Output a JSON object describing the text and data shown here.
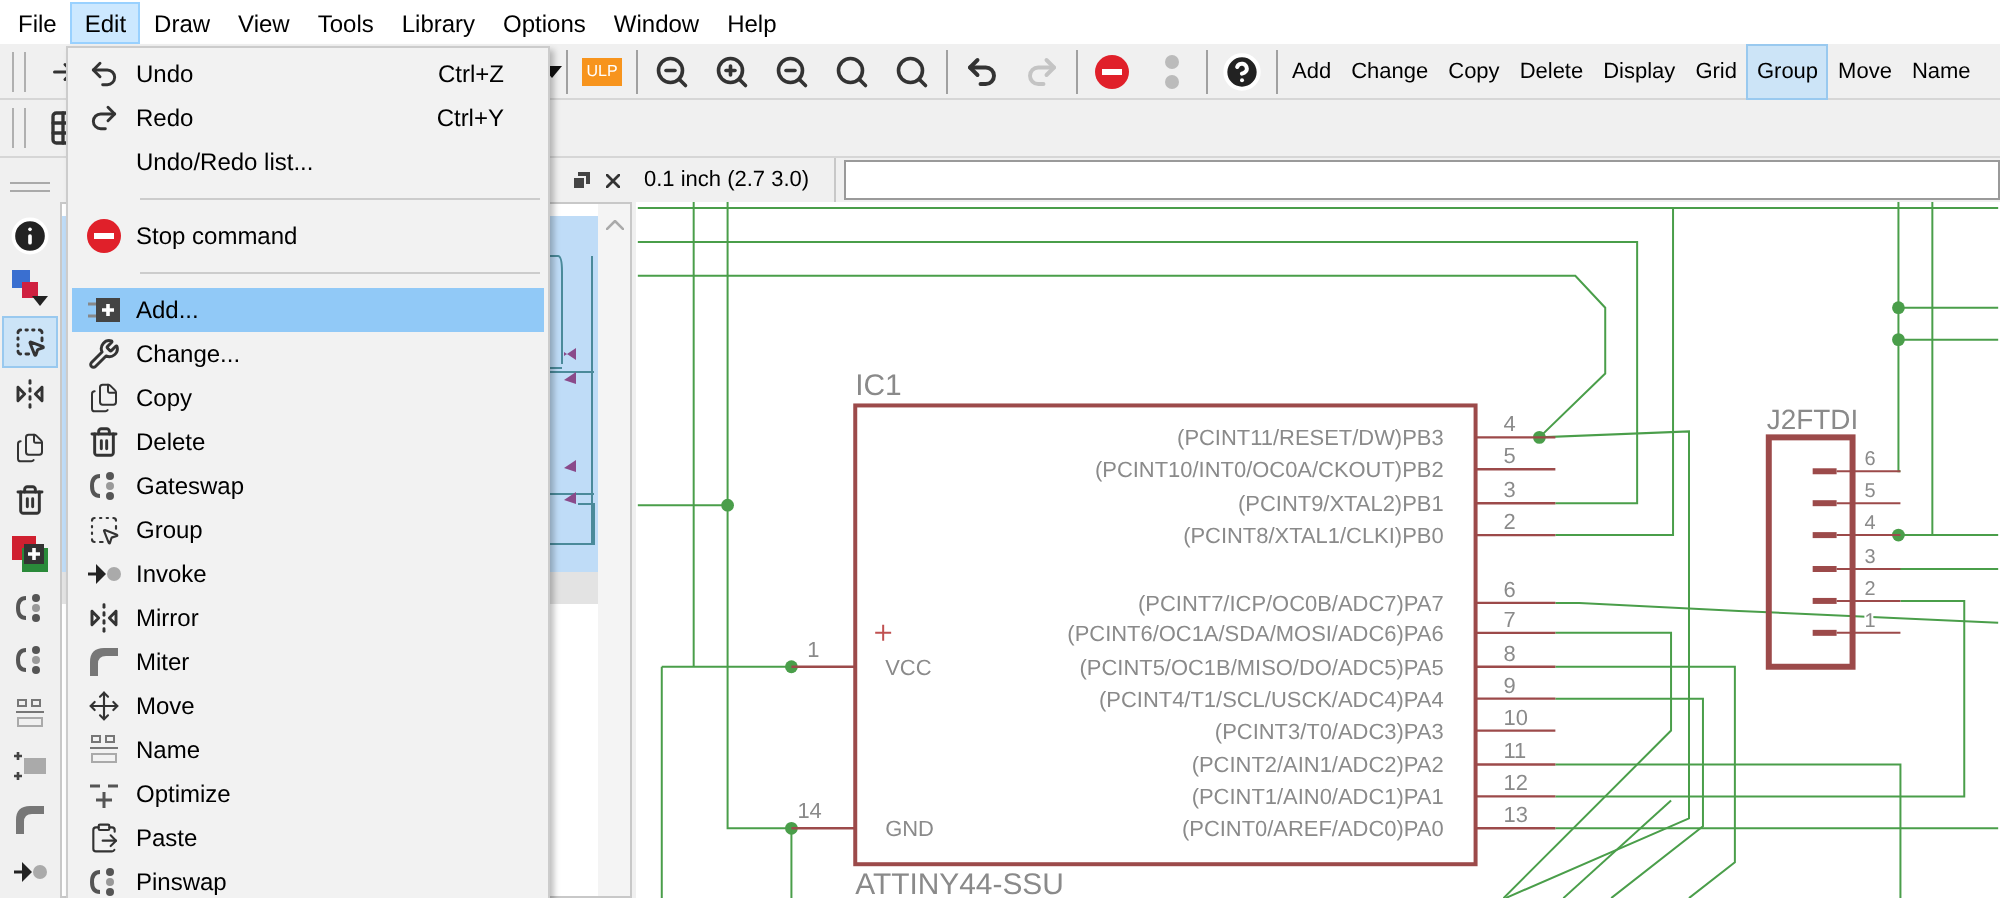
{
  "menu_bar": [
    {
      "label": "File",
      "selected": false
    },
    {
      "label": "Edit",
      "selected": true
    },
    {
      "label": "Draw",
      "selected": false
    },
    {
      "label": "View",
      "selected": false
    },
    {
      "label": "Tools",
      "selected": false
    },
    {
      "label": "Library",
      "selected": false
    },
    {
      "label": "Options",
      "selected": false
    },
    {
      "label": "Window",
      "selected": false
    },
    {
      "label": "Help",
      "selected": false
    }
  ],
  "toolbar": {
    "ulp_label": "ULP",
    "redo_disabled": true
  },
  "command_buttons": [
    {
      "label": "Add",
      "selected": false
    },
    {
      "label": "Change",
      "selected": false
    },
    {
      "label": "Copy",
      "selected": false
    },
    {
      "label": "Delete",
      "selected": false
    },
    {
      "label": "Display",
      "selected": false
    },
    {
      "label": "Grid",
      "selected": false
    },
    {
      "label": "Group",
      "selected": true
    },
    {
      "label": "Move",
      "selected": false
    },
    {
      "label": "Name",
      "selected": false
    }
  ],
  "tool_palette": [
    {
      "selected": false
    },
    {
      "selected": false
    },
    {
      "selected": true
    },
    {
      "selected": false
    },
    {
      "selected": false
    },
    {
      "selected": false
    },
    {
      "selected": false
    },
    {
      "selected": false
    },
    {
      "selected": false
    },
    {
      "selected": false
    },
    {
      "selected": false
    },
    {
      "selected": false
    },
    {
      "selected": false
    }
  ],
  "coordinate_display": "0.1 inch (2.7 3.0)",
  "edit_menu": [
    {
      "kind": "item",
      "label": "Undo",
      "shortcut": "Ctrl+Z",
      "selected": false
    },
    {
      "kind": "item",
      "label": "Redo",
      "shortcut": "Ctrl+Y",
      "selected": false
    },
    {
      "kind": "item",
      "label": "Undo/Redo list...",
      "selected": false
    },
    {
      "kind": "separator"
    },
    {
      "kind": "item",
      "label": "Stop command",
      "selected": false
    },
    {
      "kind": "separator"
    },
    {
      "kind": "item",
      "label": "Add...",
      "selected": true
    },
    {
      "kind": "item",
      "label": "Change...",
      "selected": false
    },
    {
      "kind": "item",
      "label": "Copy",
      "selected": false
    },
    {
      "kind": "item",
      "label": "Delete",
      "selected": false
    },
    {
      "kind": "item",
      "label": "Gateswap",
      "selected": false
    },
    {
      "kind": "item",
      "label": "Group",
      "selected": false
    },
    {
      "kind": "item",
      "label": "Invoke",
      "selected": false
    },
    {
      "kind": "item",
      "label": "Mirror",
      "selected": false
    },
    {
      "kind": "item",
      "label": "Miter",
      "selected": false
    },
    {
      "kind": "item",
      "label": "Move",
      "selected": false
    },
    {
      "kind": "item",
      "label": "Name",
      "selected": false
    },
    {
      "kind": "item",
      "label": "Optimize",
      "selected": false
    },
    {
      "kind": "item",
      "label": "Paste",
      "selected": false
    },
    {
      "kind": "item",
      "label": "Pinswap",
      "selected": false
    }
  ],
  "schematic": {
    "ic": {
      "name": "IC1",
      "value": "ATTINY44-SSU",
      "left_pins": [
        {
          "number": "1",
          "name": "VCC"
        },
        {
          "number": "14",
          "name": "GND"
        }
      ],
      "right_pins": [
        {
          "number": "4",
          "name": "(PCINT11/RESET/DW)PB3"
        },
        {
          "number": "5",
          "name": "(PCINT10/INT0/OC0A/CKOUT)PB2"
        },
        {
          "number": "3",
          "name": "(PCINT9/XTAL2)PB1"
        },
        {
          "number": "2",
          "name": "(PCINT8/XTAL1/CLKI)PB0"
        },
        {
          "number": "6",
          "name": "(PCINT7/ICP/OC0B/ADC7)PA7"
        },
        {
          "number": "7",
          "name": "(PCINT6/OC1A/SDA/MOSI/ADC6)PA6"
        },
        {
          "number": "8",
          "name": "(PCINT5/OC1B/MISO/DO/ADC5)PA5"
        },
        {
          "number": "9",
          "name": "(PCINT4/T1/SCL/USCK/ADC4)PA4"
        },
        {
          "number": "10",
          "name": "(PCINT3/T0/ADC3)PA3"
        },
        {
          "number": "11",
          "name": "(PCINT2/AIN1/ADC2)PA2"
        },
        {
          "number": "12",
          "name": "(PCINT1/AIN0/ADC1)PA1"
        },
        {
          "number": "13",
          "name": "(PCINT0/AREF/ADC0)PA0"
        }
      ]
    },
    "connector": {
      "name": "J2FTDI",
      "pins": [
        "6",
        "5",
        "4",
        "3",
        "2",
        "1"
      ]
    }
  }
}
